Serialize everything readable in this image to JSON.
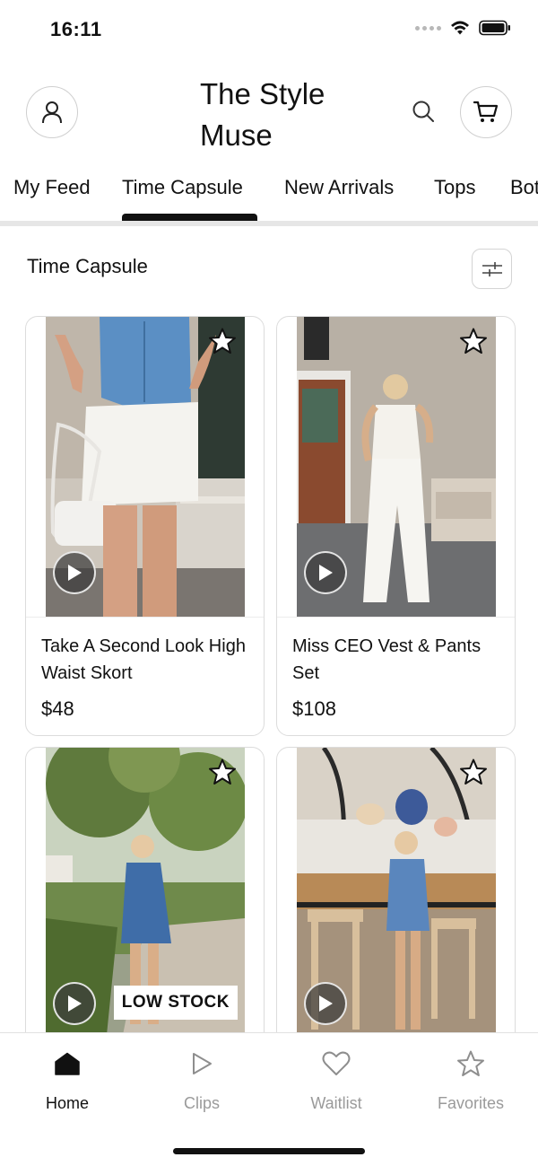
{
  "status_bar": {
    "time": "16:11"
  },
  "header": {
    "title": "The Style Muse"
  },
  "tabs": [
    {
      "label": "My Feed"
    },
    {
      "label": "Time Capsule"
    },
    {
      "label": "New Arrivals"
    },
    {
      "label": "Tops"
    },
    {
      "label": "Bottoms"
    }
  ],
  "active_tab": "Time Capsule",
  "section": {
    "title": "Time Capsule"
  },
  "products": [
    {
      "name": "Take A Second Look High Waist Skort",
      "price": "$48",
      "badge": ""
    },
    {
      "name": "Miss CEO Vest & Pants Set",
      "price": "$108",
      "badge": ""
    },
    {
      "name": "",
      "price": "",
      "badge": "LOW STOCK"
    },
    {
      "name": "",
      "price": "",
      "badge": ""
    }
  ],
  "bottom_nav": [
    {
      "label": "Home",
      "icon": "home-icon",
      "active": true
    },
    {
      "label": "Clips",
      "icon": "play-icon",
      "active": false
    },
    {
      "label": "Waitlist",
      "icon": "heart-icon",
      "active": false
    },
    {
      "label": "Favorites",
      "icon": "star-icon",
      "active": false
    }
  ],
  "colors": {
    "accent": "#111111",
    "inactive": "#9a9a9a",
    "divider": "#e6e6e6"
  }
}
